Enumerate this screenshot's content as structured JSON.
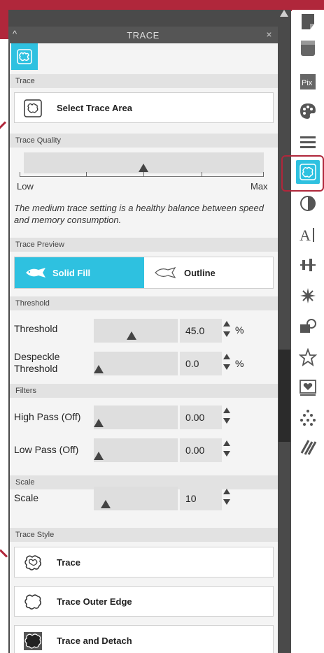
{
  "panel": {
    "title": "TRACE",
    "collapse_glyph": "^",
    "close_glyph": "×"
  },
  "sections": {
    "trace": "Trace",
    "trace_quality": "Trace Quality",
    "trace_preview": "Trace Preview",
    "threshold": "Threshold",
    "filters": "Filters",
    "scale": "Scale",
    "trace_style": "Trace Style"
  },
  "buttons": {
    "select_trace_area": "Select Trace Area"
  },
  "quality": {
    "low_label": "Low",
    "max_label": "Max",
    "level": 0.5,
    "description": "The medium trace setting is a healthy balance between speed and memory consumption."
  },
  "preview": {
    "solid_fill": "Solid Fill",
    "outline": "Outline",
    "selected": "Solid Fill"
  },
  "threshold_rows": {
    "threshold": {
      "label": "Threshold",
      "value": "45.0",
      "unit": "%"
    },
    "despeckle": {
      "label": "Despeckle Threshold",
      "value": "0.0",
      "unit": "%"
    }
  },
  "filter_rows": {
    "high_pass": {
      "label": "High Pass (Off)",
      "value": "0.00"
    },
    "low_pass": {
      "label": "Low Pass (Off)",
      "value": "0.00"
    }
  },
  "scale_row": {
    "label": "Scale",
    "value": "10"
  },
  "styles": {
    "trace": "Trace",
    "trace_outer_edge": "Trace Outer Edge",
    "trace_and_detach": "Trace and Detach"
  },
  "colors": {
    "accent": "#2ec1e0",
    "highlight": "#b0273b",
    "panel_dark": "#4a4a4a"
  },
  "toolbar_icons": [
    "page-icon",
    "shadow-icon",
    "pix-icon",
    "palette-icon",
    "lines-icon",
    "trace-icon",
    "contrast-icon",
    "text-icon",
    "align-icon",
    "replicate-icon",
    "transform-icon",
    "star-icon",
    "heart-icon",
    "dots-icon",
    "knife-icon"
  ]
}
